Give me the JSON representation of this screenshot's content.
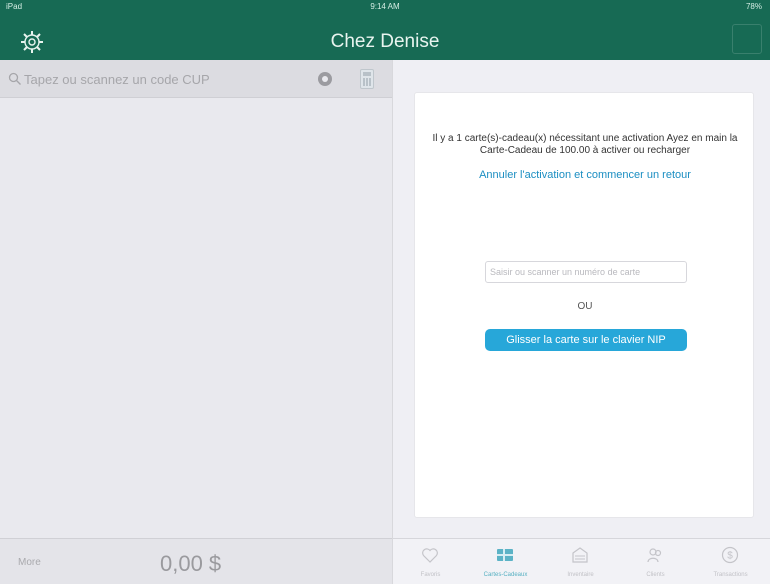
{
  "status": {
    "left": "iPad",
    "time": "9:14 AM",
    "battery": "78%"
  },
  "header": {
    "title": "Chez Denise"
  },
  "left": {
    "search_placeholder": "Tapez ou scannez un code CUP",
    "more_label": "More",
    "total": "0,00 $"
  },
  "activation": {
    "message": "Il y a 1 carte(s)-cadeau(x) nécessitant une activation Ayez en main la Carte-Cadeau de 100.00 à activer ou recharger",
    "cancel_link": "Annuler l'activation et commencer un retour",
    "card_placeholder": "Saisir ou scanner un numéro de carte",
    "or_label": "OU",
    "swipe_button": "Glisser la carte sur le clavier NIP"
  },
  "tabs": [
    {
      "label": "Favoris",
      "icon": "heart-icon"
    },
    {
      "label": "Cartes-Cadeaux",
      "icon": "gift-card-icon",
      "active": true
    },
    {
      "label": "Inventaire",
      "icon": "inventory-icon"
    },
    {
      "label": "Clients",
      "icon": "clients-icon"
    },
    {
      "label": "Transactions",
      "icon": "dollar-icon"
    }
  ],
  "colors": {
    "header": "#176a54",
    "accent": "#27a7d9",
    "link": "#1b8ec2"
  }
}
